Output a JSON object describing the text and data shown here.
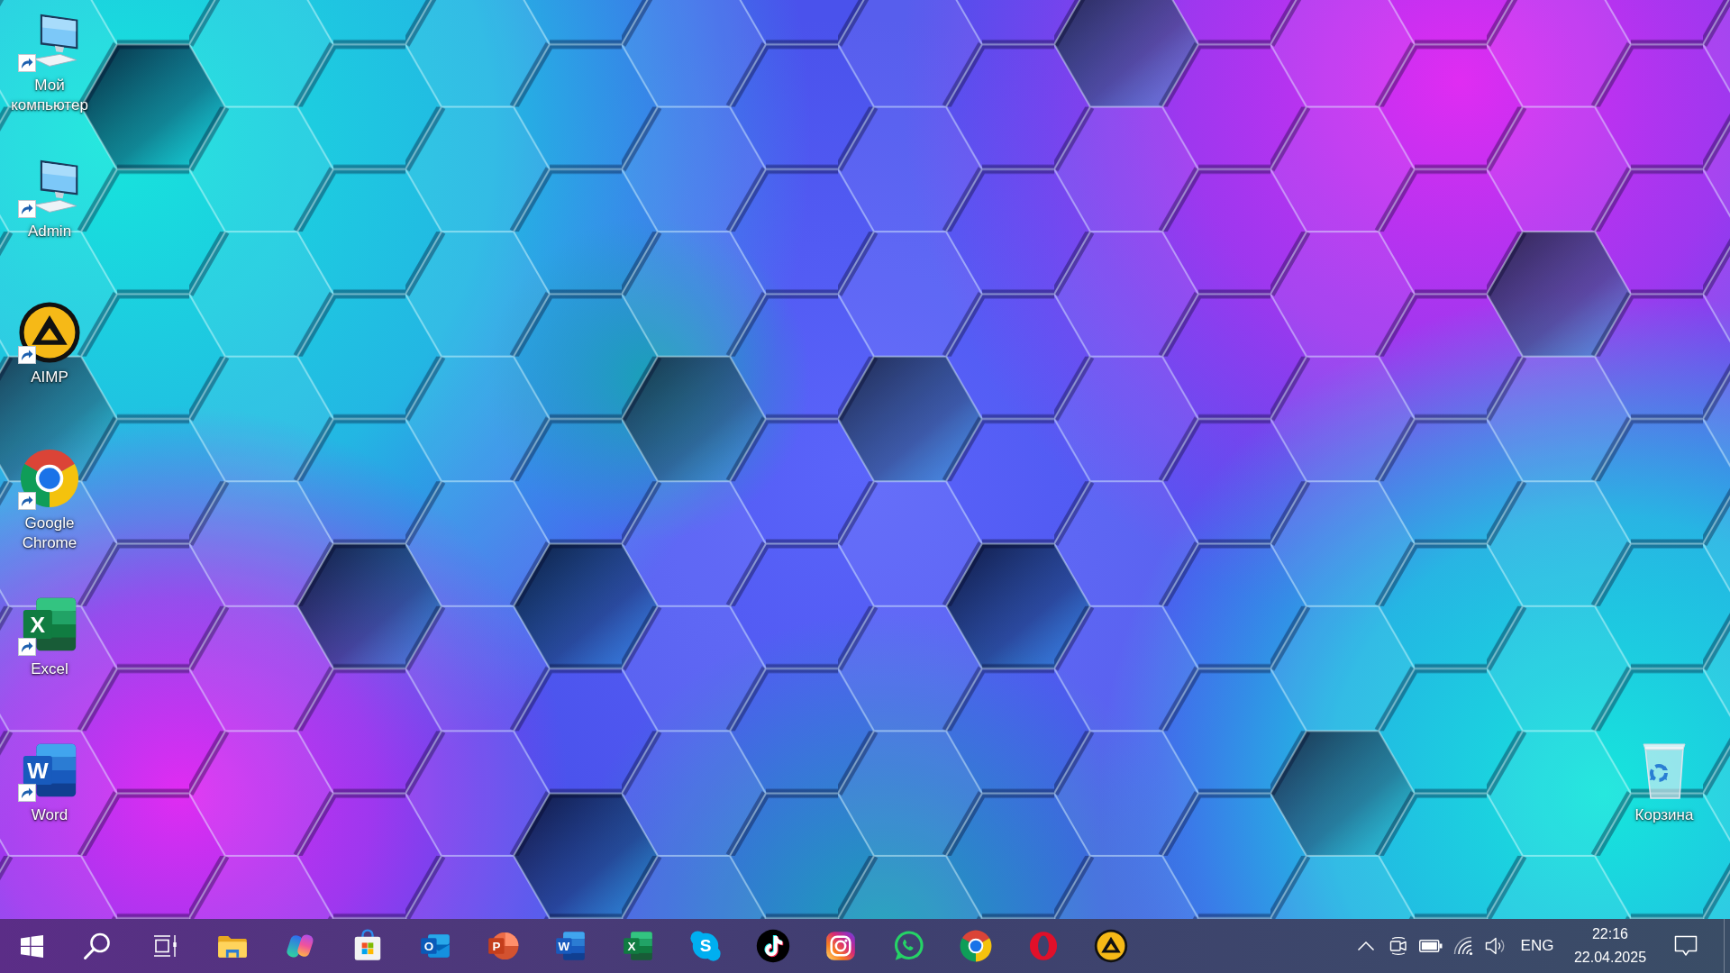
{
  "desktop": {
    "icons": [
      {
        "label": "Мой компьютер",
        "kind": "computer",
        "shortcut": true
      },
      {
        "label": "Admin",
        "kind": "computer",
        "shortcut": true
      },
      {
        "label": "AIMP",
        "kind": "aimp",
        "shortcut": true
      },
      {
        "label": "Google Chrome",
        "kind": "chrome",
        "shortcut": true
      },
      {
        "label": "Excel",
        "kind": "excel",
        "letter": "X",
        "shortcut": true
      },
      {
        "label": "Word",
        "kind": "word",
        "letter": "W",
        "shortcut": true
      }
    ],
    "recycle_bin": {
      "label": "Корзина"
    }
  },
  "taskbar": {
    "buttons": [
      {
        "kind": "start"
      },
      {
        "kind": "search"
      },
      {
        "kind": "task_view"
      },
      {
        "kind": "explorer"
      },
      {
        "kind": "copilot"
      },
      {
        "kind": "store"
      },
      {
        "kind": "outlook",
        "letter": "O"
      },
      {
        "kind": "powerpoint",
        "letter": "P"
      },
      {
        "kind": "word",
        "letter": "W"
      },
      {
        "kind": "excel",
        "letter": "X"
      },
      {
        "kind": "skype",
        "letter": "S"
      },
      {
        "kind": "tiktok"
      },
      {
        "kind": "instagram"
      },
      {
        "kind": "whatsapp"
      },
      {
        "kind": "chrome"
      },
      {
        "kind": "opera"
      },
      {
        "kind": "aimp"
      }
    ],
    "tray": {
      "icons": [
        {
          "kind": "chevron"
        },
        {
          "kind": "camera"
        },
        {
          "kind": "battery"
        },
        {
          "kind": "wifi"
        },
        {
          "kind": "volume"
        }
      ],
      "language": "ENG",
      "time": "22:16",
      "date": "22.04.2025"
    }
  }
}
